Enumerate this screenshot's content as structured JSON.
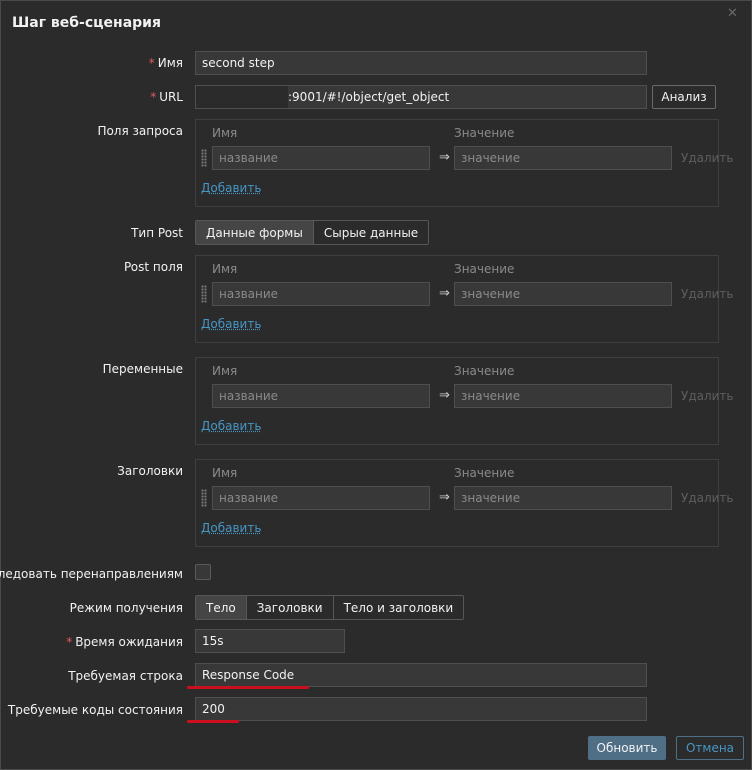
{
  "dialog": {
    "title": "Шаг веб-сценария",
    "close_icon": "close-icon"
  },
  "form": {
    "required_mark": "*",
    "name": {
      "label": "Имя",
      "value": "second step"
    },
    "url": {
      "label": "URL",
      "value": ":9001/#!/object/get_object",
      "parse_button": "Анализ"
    },
    "query_fields": {
      "label": "Поля запроса",
      "col_name": "Имя",
      "col_value": "Значение",
      "row": {
        "name_placeholder": "название",
        "value_placeholder": "значение",
        "remove": "Удалить"
      },
      "add": "Добавить"
    },
    "post_type": {
      "label": "Тип Post",
      "options": [
        "Данные формы",
        "Сырые данные"
      ],
      "selected": "Данные формы"
    },
    "post_fields": {
      "label": "Post поля",
      "col_name": "Имя",
      "col_value": "Значение",
      "row": {
        "name_placeholder": "название",
        "value_placeholder": "значение",
        "remove": "Удалить"
      },
      "add": "Добавить"
    },
    "variables": {
      "label": "Переменные",
      "col_name": "Имя",
      "col_value": "Значение",
      "row": {
        "name_placeholder": "название",
        "value_placeholder": "значение",
        "remove": "Удалить"
      },
      "add": "Добавить"
    },
    "headers": {
      "label": "Заголовки",
      "col_name": "Имя",
      "col_value": "Значение",
      "row": {
        "name_placeholder": "название",
        "value_placeholder": "значение",
        "remove": "Удалить"
      },
      "add": "Добавить"
    },
    "follow_redirects": {
      "label": "Следовать перенаправлениям",
      "checked": false
    },
    "retrieve_mode": {
      "label": "Режим получения",
      "options": [
        "Тело",
        "Заголовки",
        "Тело и заголовки"
      ],
      "selected": "Тело"
    },
    "timeout": {
      "label": "Время ожидания",
      "value": "15s"
    },
    "required_string": {
      "label": "Требуемая строка",
      "value": "Response Code"
    },
    "status_codes": {
      "label": "Требуемые коды состояния",
      "value": "200"
    }
  },
  "footer": {
    "update_button": "Обновить",
    "cancel_button": "Отмена"
  },
  "colors": {
    "background": "#2b2b2b",
    "required": "#e45959",
    "link": "#4796c4",
    "annotation": "#cc0f1e",
    "primary_button": "#4f6f86"
  }
}
